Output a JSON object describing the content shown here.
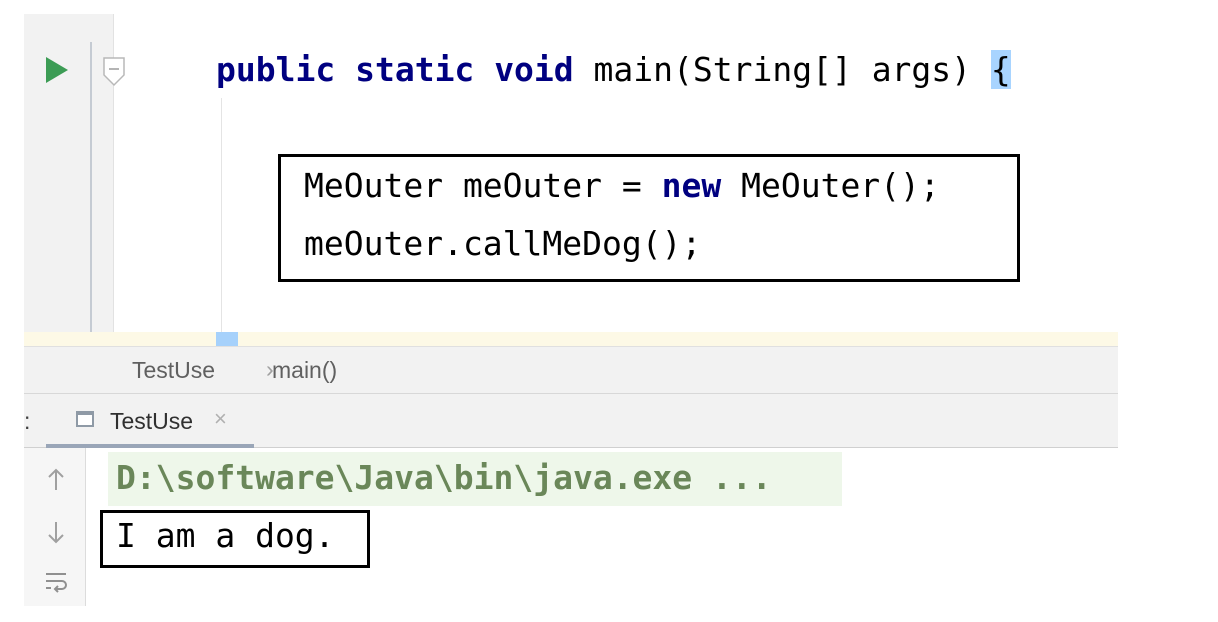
{
  "editor": {
    "line1": {
      "kw_public": "public",
      "kw_static": "static",
      "kw_void": "void",
      "method_sig": "main(String[] args)",
      "open_brace": "{"
    },
    "line2": {
      "decl": "MeOuter meOuter = ",
      "kw_new": "new",
      "ctor": " MeOuter();"
    },
    "line3": "meOuter.callMeDog();"
  },
  "breadcrumb": {
    "items": [
      "TestUse",
      "main()"
    ],
    "separator": "›"
  },
  "run_panel": {
    "label_suffix": ":",
    "tab_label": "TestUse",
    "tab_close": "×"
  },
  "console": {
    "command_line": "D:\\software\\Java\\bin\\java.exe ...",
    "output": "I am a dog.",
    "gutter_icons": [
      "up-arrow-icon",
      "down-arrow-icon",
      "soft-wrap-icon"
    ]
  },
  "colors": {
    "keyword": "#000080",
    "run_icon": "#3c9c55",
    "brace_highlight": "#a8d4ff",
    "command_text": "#6a8759",
    "command_bg": "#eef7ea"
  }
}
